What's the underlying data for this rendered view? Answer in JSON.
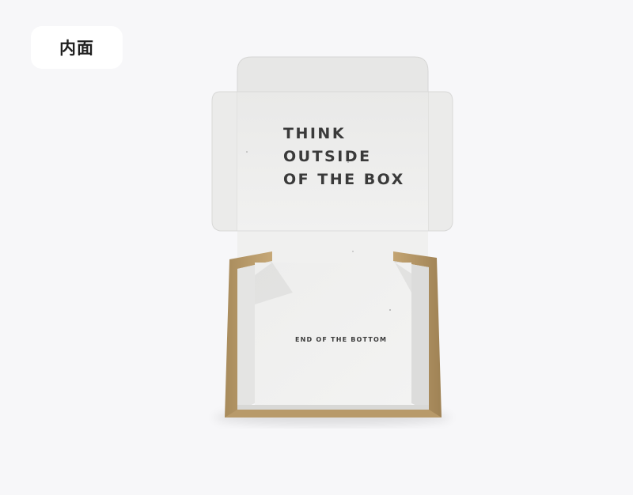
{
  "badge": {
    "label": "内面"
  },
  "box": {
    "lid_lines": [
      "THINK",
      "OUTSIDE",
      "OF THE BOX"
    ],
    "bottom_text": "END OF THE BOTTOM"
  },
  "colors": {
    "background": "#f7f7f9",
    "board_white": "#f2f2f1",
    "kraft": "#b89a6a",
    "print": "#3a3a3a"
  }
}
